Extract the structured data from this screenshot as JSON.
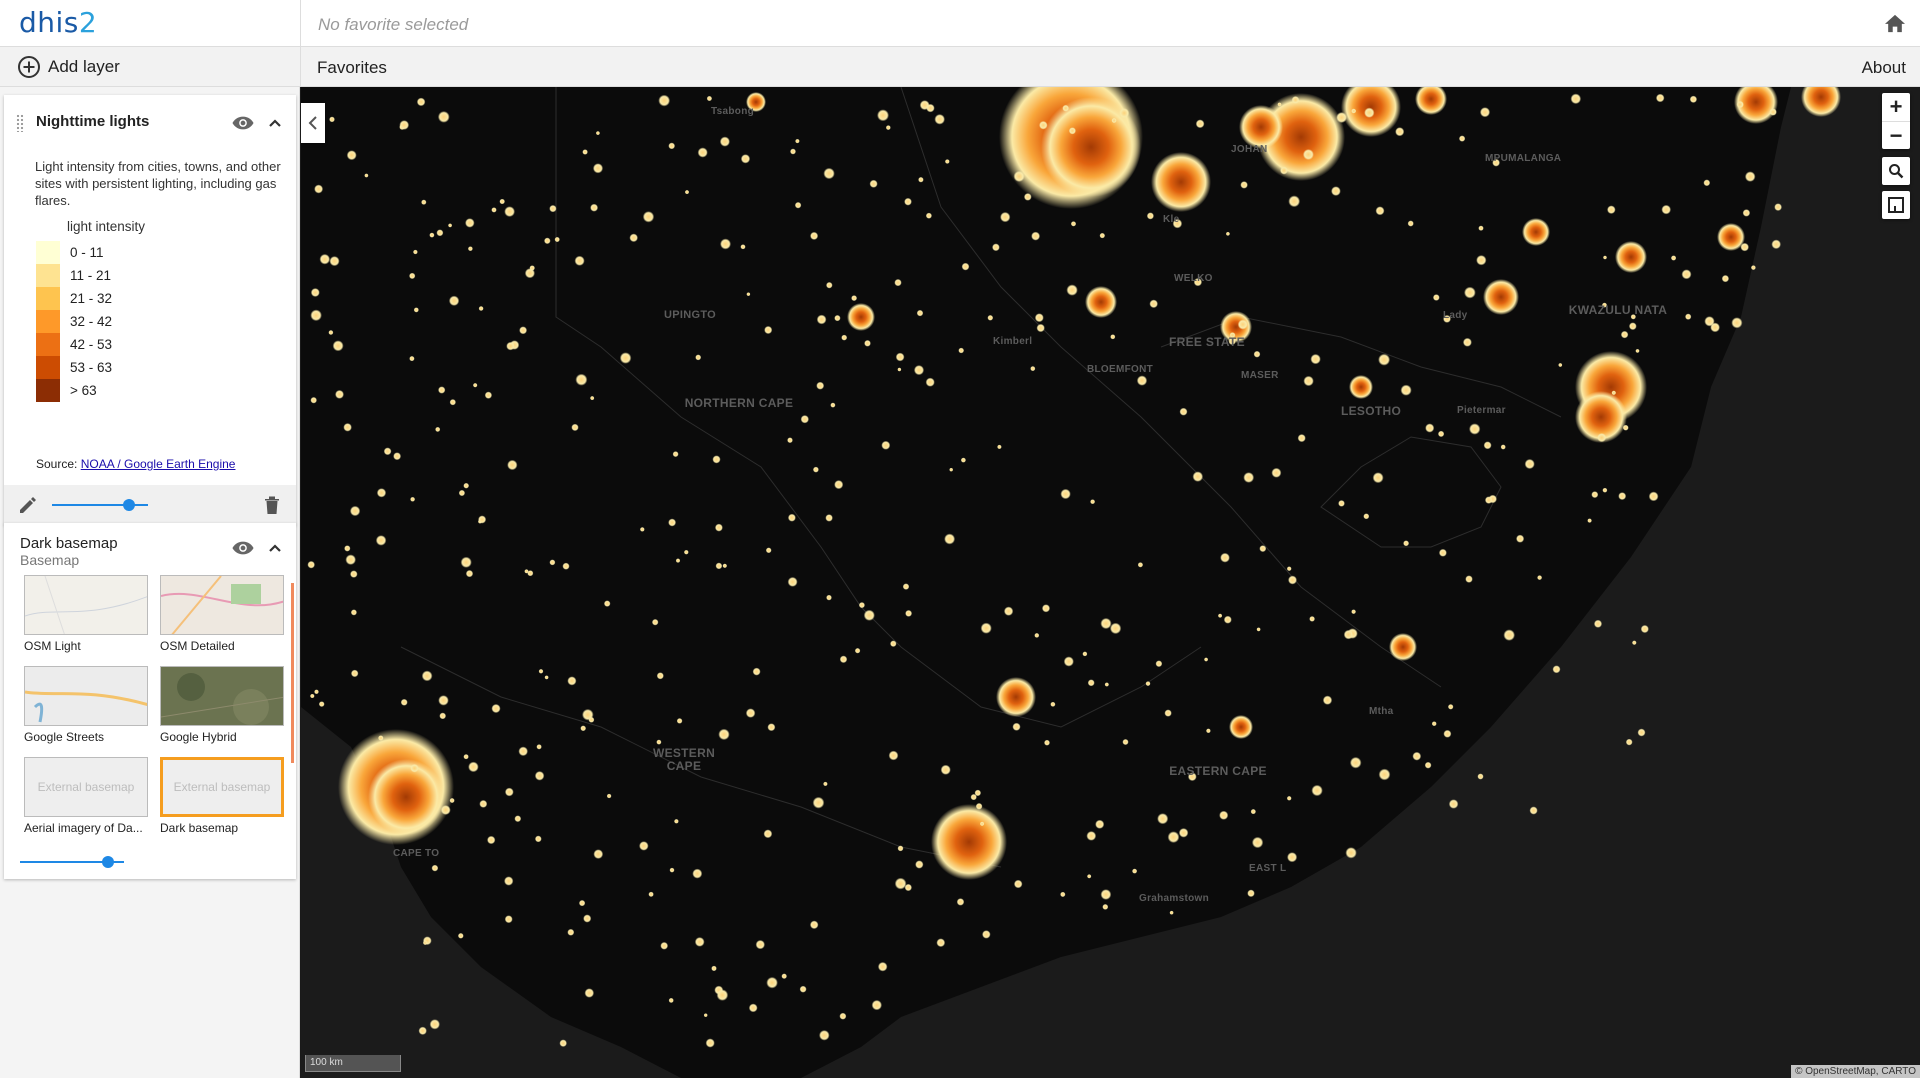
{
  "app": {
    "logo": "dhis",
    "logo_accent": "2"
  },
  "header": {
    "favorite_placeholder": "No favorite selected"
  },
  "toolbar": {
    "add_layer": "Add layer",
    "favorites": "Favorites",
    "about": "About"
  },
  "layers": {
    "nighttime": {
      "title": "Nighttime lights",
      "description": "Light intensity from cities, towns, and other sites with persistent lighting, including gas flares.",
      "legend_title": "light intensity",
      "legend": [
        {
          "label": "0 - 11",
          "color": "#ffffd4"
        },
        {
          "label": "11 - 21",
          "color": "#fee391"
        },
        {
          "label": "21 - 32",
          "color": "#fec44f"
        },
        {
          "label": "32 - 42",
          "color": "#fe9929"
        },
        {
          "label": "42 - 53",
          "color": "#ec7014"
        },
        {
          "label": "53 - 63",
          "color": "#cc4c02"
        },
        {
          "label": "> 63",
          "color": "#8c2d04"
        }
      ],
      "source_prefix": "Source: ",
      "source_link": "NOAA / Google Earth Engine",
      "opacity": 0.8
    },
    "basemap": {
      "title": "Dark basemap",
      "subtitle": "Basemap",
      "opacity": 0.85,
      "options": [
        {
          "label": "OSM Light",
          "kind": "osm-light"
        },
        {
          "label": "OSM Detailed",
          "kind": "osm-detailed"
        },
        {
          "label": "Google Streets",
          "kind": "google-streets"
        },
        {
          "label": "Google Hybrid",
          "kind": "google-hybrid"
        },
        {
          "label": "Aerial imagery of Da...",
          "kind": "external",
          "placeholder": "External basemap"
        },
        {
          "label": "Dark basemap",
          "kind": "external",
          "placeholder": "External basemap",
          "selected": true
        }
      ]
    }
  },
  "map": {
    "controls": {
      "zoom_in": "+",
      "zoom_out": "−"
    },
    "scale": "100 km",
    "attribution": "© OpenStreetMap, CARTO",
    "place_labels": {
      "tsabong": "Tsabong",
      "upington": "UPINGTO",
      "northern_cape": "NORTHERN CAPE",
      "kimberley": "Kimberl",
      "bloemfontein": "BLOEMFONT",
      "free_state": "FREE STATE",
      "welkom": "WELKO",
      "kwazulu_natal": "KWAZULU NATA",
      "lesotho": "LESOTHO",
      "western_cape": "WESTERN CAPE",
      "eastern_cape": "EASTERN CAPE",
      "cape_town": "CAPE TO",
      "east_london": "EAST L",
      "grahamstown": "Grahamstown",
      "pietermaritzburg": "Pietermar",
      "mthatha": "Mtha",
      "mpumalanga": "MPUMALANGA",
      "johannesburg": "JOHAN",
      "klerksdorp": "Kle",
      "maseru": "MASER",
      "ladysmith": "Lady"
    }
  }
}
